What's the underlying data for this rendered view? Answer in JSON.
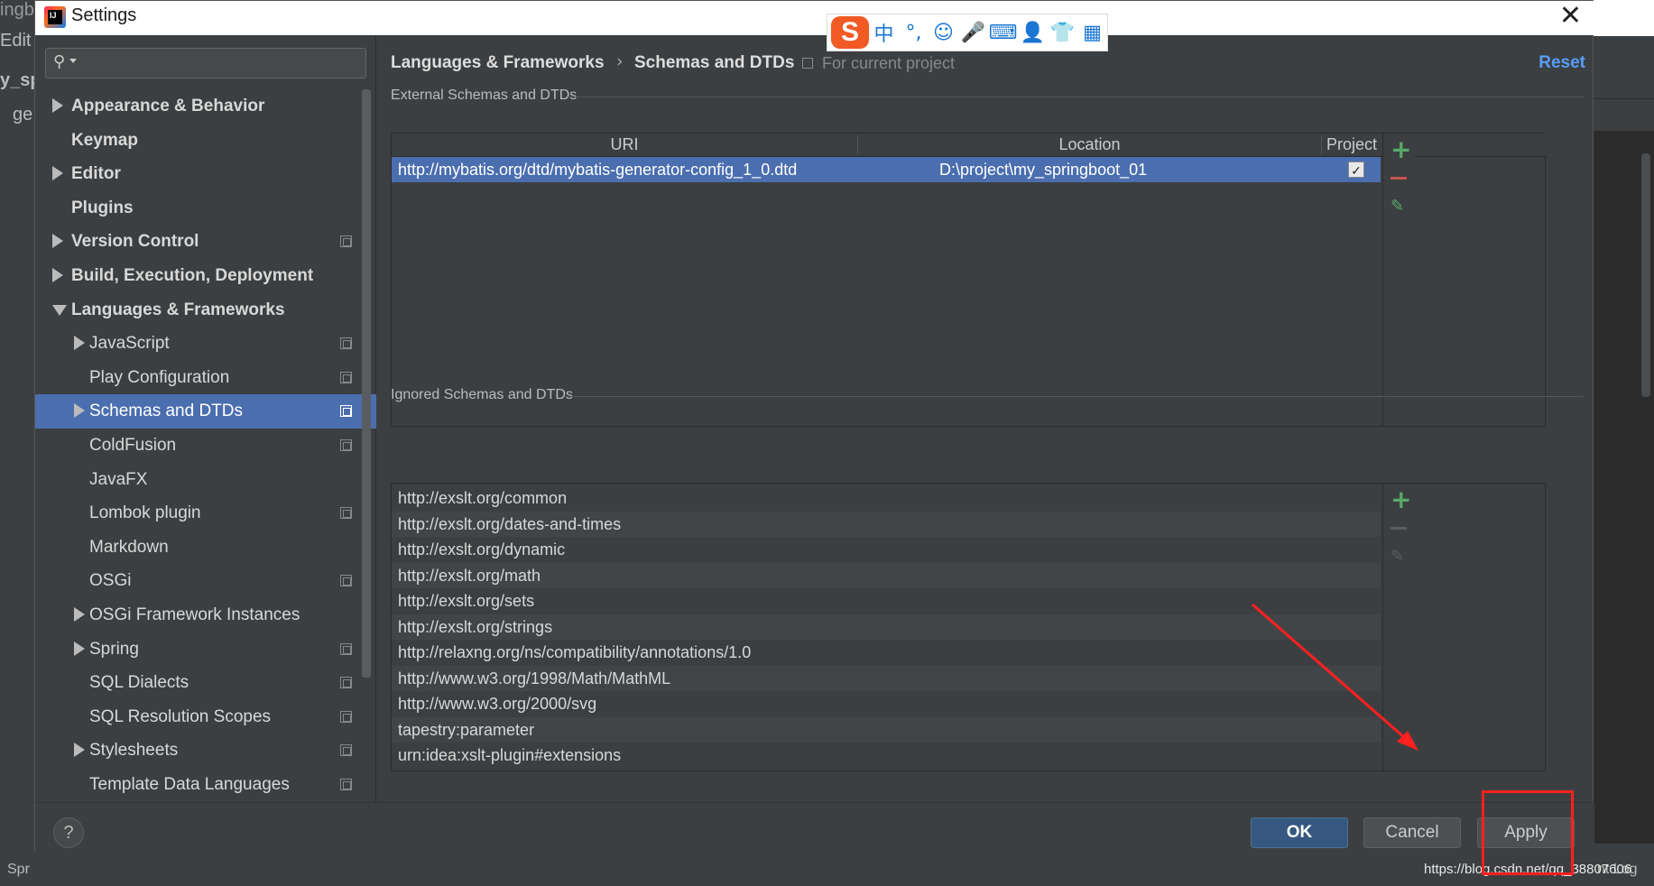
{
  "background": {
    "left_fragments": [
      "ingb",
      "Edit",
      "y_sp",
      "ge"
    ],
    "bottom_left": "Spr",
    "right_fragment": "nt Log",
    "watermark_url": "https://blog.csdn.net/qq_38807606"
  },
  "dialog": {
    "title": "Settings",
    "close_glyph": "✕"
  },
  "ime_toolbar": {
    "logo": "S",
    "items": [
      "中",
      "°,",
      "☺",
      "🎤",
      "⌨",
      "👤",
      "👕",
      "▦"
    ]
  },
  "sidebar": {
    "search_placeholder": "",
    "items": [
      {
        "label": "Appearance & Behavior",
        "arrow": "right",
        "bold": true,
        "indent": 0,
        "project_icon": false,
        "selected": false
      },
      {
        "label": "Keymap",
        "arrow": "none",
        "bold": true,
        "indent": 0,
        "project_icon": false,
        "selected": false
      },
      {
        "label": "Editor",
        "arrow": "right",
        "bold": true,
        "indent": 0,
        "project_icon": false,
        "selected": false
      },
      {
        "label": "Plugins",
        "arrow": "none",
        "bold": true,
        "indent": 0,
        "project_icon": false,
        "selected": false
      },
      {
        "label": "Version Control",
        "arrow": "right",
        "bold": true,
        "indent": 0,
        "project_icon": true,
        "selected": false
      },
      {
        "label": "Build, Execution, Deployment",
        "arrow": "right",
        "bold": true,
        "indent": 0,
        "project_icon": false,
        "selected": false
      },
      {
        "label": "Languages & Frameworks",
        "arrow": "down",
        "bold": true,
        "indent": 0,
        "project_icon": false,
        "selected": false
      },
      {
        "label": "JavaScript",
        "arrow": "right",
        "bold": false,
        "indent": 1,
        "project_icon": true,
        "selected": false
      },
      {
        "label": "Play Configuration",
        "arrow": "none",
        "bold": false,
        "indent": 1,
        "project_icon": true,
        "selected": false
      },
      {
        "label": "Schemas and DTDs",
        "arrow": "right",
        "bold": false,
        "indent": 1,
        "project_icon": true,
        "selected": true
      },
      {
        "label": "ColdFusion",
        "arrow": "none",
        "bold": false,
        "indent": 1,
        "project_icon": true,
        "selected": false
      },
      {
        "label": "JavaFX",
        "arrow": "none",
        "bold": false,
        "indent": 1,
        "project_icon": false,
        "selected": false
      },
      {
        "label": "Lombok plugin",
        "arrow": "none",
        "bold": false,
        "indent": 1,
        "project_icon": true,
        "selected": false
      },
      {
        "label": "Markdown",
        "arrow": "none",
        "bold": false,
        "indent": 1,
        "project_icon": false,
        "selected": false
      },
      {
        "label": "OSGi",
        "arrow": "none",
        "bold": false,
        "indent": 1,
        "project_icon": true,
        "selected": false
      },
      {
        "label": "OSGi Framework Instances",
        "arrow": "right",
        "bold": false,
        "indent": 1,
        "project_icon": false,
        "selected": false
      },
      {
        "label": "Spring",
        "arrow": "right",
        "bold": false,
        "indent": 1,
        "project_icon": true,
        "selected": false
      },
      {
        "label": "SQL Dialects",
        "arrow": "none",
        "bold": false,
        "indent": 1,
        "project_icon": true,
        "selected": false
      },
      {
        "label": "SQL Resolution Scopes",
        "arrow": "none",
        "bold": false,
        "indent": 1,
        "project_icon": true,
        "selected": false
      },
      {
        "label": "Stylesheets",
        "arrow": "right",
        "bold": false,
        "indent": 1,
        "project_icon": true,
        "selected": false
      },
      {
        "label": "Template Data Languages",
        "arrow": "none",
        "bold": false,
        "indent": 1,
        "project_icon": true,
        "selected": false
      }
    ]
  },
  "main": {
    "breadcrumb_parent": "Languages & Frameworks",
    "breadcrumb_sep": "›",
    "breadcrumb_current": "Schemas and DTDs",
    "scope": "For current project",
    "reset_label": "Reset",
    "external": {
      "title": "External Schemas and DTDs",
      "columns": [
        "URI",
        "Location",
        "Project"
      ],
      "rows": [
        {
          "uri": "http://mybatis.org/dtd/mybatis-generator-config_1_0.dtd",
          "location": "D:\\project\\my_springboot_01",
          "project": true
        }
      ]
    },
    "ignored": {
      "title": "Ignored Schemas and DTDs",
      "rows": [
        "http://exslt.org/common",
        "http://exslt.org/dates-and-times",
        "http://exslt.org/dynamic",
        "http://exslt.org/math",
        "http://exslt.org/sets",
        "http://exslt.org/strings",
        "http://relaxng.org/ns/compatibility/annotations/1.0",
        "http://www.w3.org/1998/Math/MathML",
        "http://www.w3.org/2000/svg",
        "tapestry:parameter",
        "urn:idea:xslt-plugin#extensions"
      ]
    },
    "tools": {
      "add": "+",
      "edit": "✎"
    }
  },
  "footer": {
    "help": "?",
    "ok": "OK",
    "cancel": "Cancel",
    "apply": "Apply"
  },
  "colors": {
    "selection": "#4b6eaf",
    "accent_link": "#589df6",
    "add_green": "#59a869",
    "remove_red": "#c75450",
    "annotation_red": "#ff2020"
  }
}
